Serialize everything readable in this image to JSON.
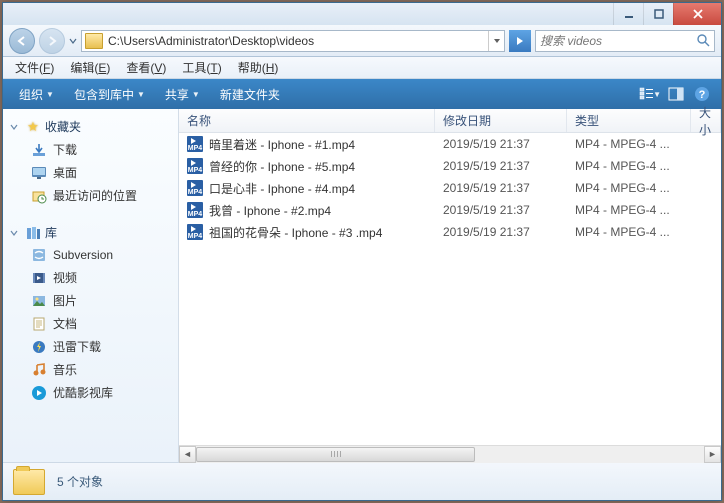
{
  "window": {
    "path": "C:\\Users\\Administrator\\Desktop\\videos",
    "search_placeholder": "搜索 videos"
  },
  "menubar": [
    {
      "label": "文件",
      "hotkey": "F"
    },
    {
      "label": "编辑",
      "hotkey": "E"
    },
    {
      "label": "查看",
      "hotkey": "V"
    },
    {
      "label": "工具",
      "hotkey": "T"
    },
    {
      "label": "帮助",
      "hotkey": "H"
    }
  ],
  "toolbar": {
    "organize": "组织",
    "include": "包含到库中",
    "share": "共享",
    "new_folder": "新建文件夹"
  },
  "sidebar": {
    "favorites": {
      "label": "收藏夹",
      "items": [
        {
          "icon": "download-icon",
          "label": "下载"
        },
        {
          "icon": "desktop-icon",
          "label": "桌面"
        },
        {
          "icon": "recent-icon",
          "label": "最近访问的位置"
        }
      ]
    },
    "libraries": {
      "label": "库",
      "items": [
        {
          "icon": "subversion-icon",
          "label": "Subversion"
        },
        {
          "icon": "video-icon",
          "label": "视频"
        },
        {
          "icon": "pictures-icon",
          "label": "图片"
        },
        {
          "icon": "documents-icon",
          "label": "文档"
        },
        {
          "icon": "xunlei-icon",
          "label": "迅雷下载"
        },
        {
          "icon": "music-icon",
          "label": "音乐"
        },
        {
          "icon": "youku-icon",
          "label": "优酷影视库"
        }
      ]
    }
  },
  "columns": {
    "name": "名称",
    "date": "修改日期",
    "type": "类型",
    "size": "大小"
  },
  "files": [
    {
      "name": "暗里着迷 - Iphone - #1.mp4",
      "date": "2019/5/19 21:37",
      "type": "MP4 - MPEG-4 ..."
    },
    {
      "name": "曾经的你 - Iphone - #5.mp4",
      "date": "2019/5/19 21:37",
      "type": "MP4 - MPEG-4 ..."
    },
    {
      "name": "口是心非 - Iphone - #4.mp4",
      "date": "2019/5/19 21:37",
      "type": "MP4 - MPEG-4 ..."
    },
    {
      "name": "我曾 - Iphone - #2.mp4",
      "date": "2019/5/19 21:37",
      "type": "MP4 - MPEG-4 ..."
    },
    {
      "name": "祖国的花骨朵 - Iphone - #3 .mp4",
      "date": "2019/5/19 21:37",
      "type": "MP4 - MPEG-4 ..."
    }
  ],
  "status": {
    "count_label": "5 个对象"
  }
}
